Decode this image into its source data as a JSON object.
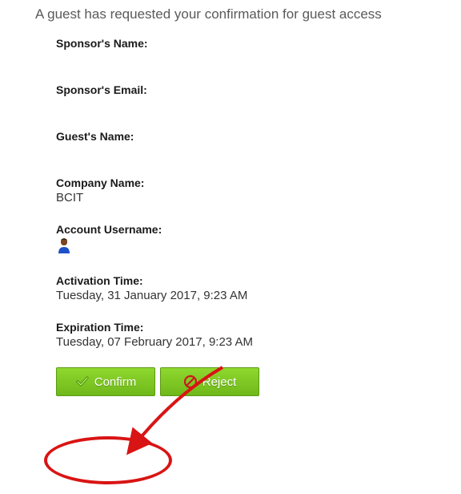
{
  "header": "A guest has requested your confirmation for guest access",
  "fields": {
    "sponsor_name": {
      "label": "Sponsor's Name:",
      "value": ""
    },
    "sponsor_email": {
      "label": "Sponsor's Email:",
      "value": ""
    },
    "guest_name": {
      "label": "Guest's Name:",
      "value": ""
    },
    "company_name": {
      "label": "Company Name:",
      "value": "BCIT"
    },
    "account_username": {
      "label": "Account Username:",
      "value": ""
    },
    "activation_time": {
      "label": "Activation Time:",
      "value": "Tuesday, 31 January 2017, 9:23 AM"
    },
    "expiration_time": {
      "label": "Expiration Time:",
      "value": "Tuesday, 07 February 2017, 9:23 AM"
    }
  },
  "buttons": {
    "confirm": "Confirm",
    "reject": "Reject"
  }
}
